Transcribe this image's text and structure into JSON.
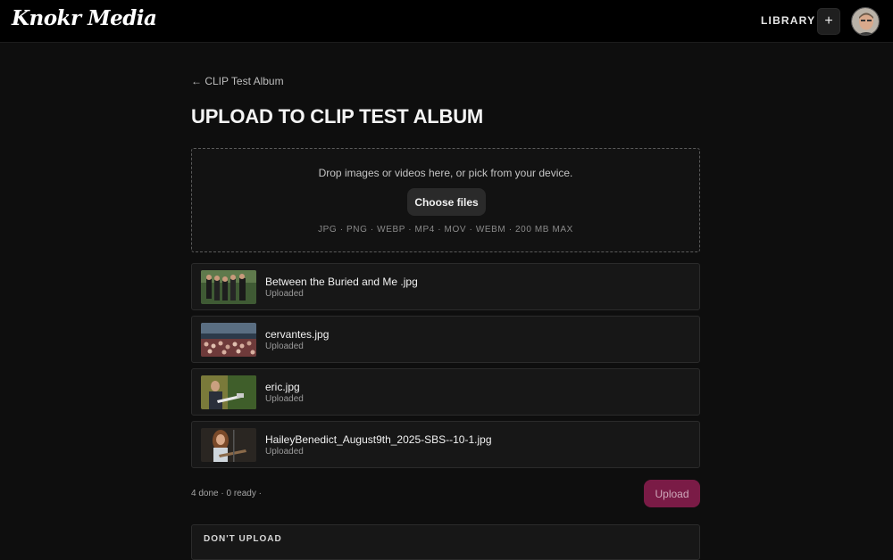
{
  "header": {
    "logo": "Knokr Media",
    "nav_library": "LIBRARY",
    "add_label": "+"
  },
  "main": {
    "back_link": "← CLIP Test Album",
    "title": "UPLOAD TO CLIP TEST ALBUM",
    "dropzone": {
      "instructions": "Drop images or videos here, or pick from your device.",
      "choose_button": "Choose files",
      "formats": "JPG · PNG · WEBP · MP4 · MOV · WEBM · 200 MB MAX"
    },
    "files": [
      {
        "name": "Between the Buried and Me .jpg",
        "status": "Uploaded",
        "thumbnail": "band-photo"
      },
      {
        "name": "cervantes.jpg",
        "status": "Uploaded",
        "thumbnail": "crowd-photo"
      },
      {
        "name": "eric.jpg",
        "status": "Uploaded",
        "thumbnail": "guitarist-photo"
      },
      {
        "name": "HaileyBenedict_August9th_2025-SBS--10-1.jpg",
        "status": "Uploaded",
        "thumbnail": "performer-photo"
      }
    ],
    "summary": "4 done · 0 ready ·",
    "upload_button": "Upload",
    "dont_upload_label": "DON'T UPLOAD"
  },
  "colors": {
    "background": "#0e0e0e",
    "header": "#000000",
    "accent": "#7a1b46",
    "card": "#171717"
  }
}
